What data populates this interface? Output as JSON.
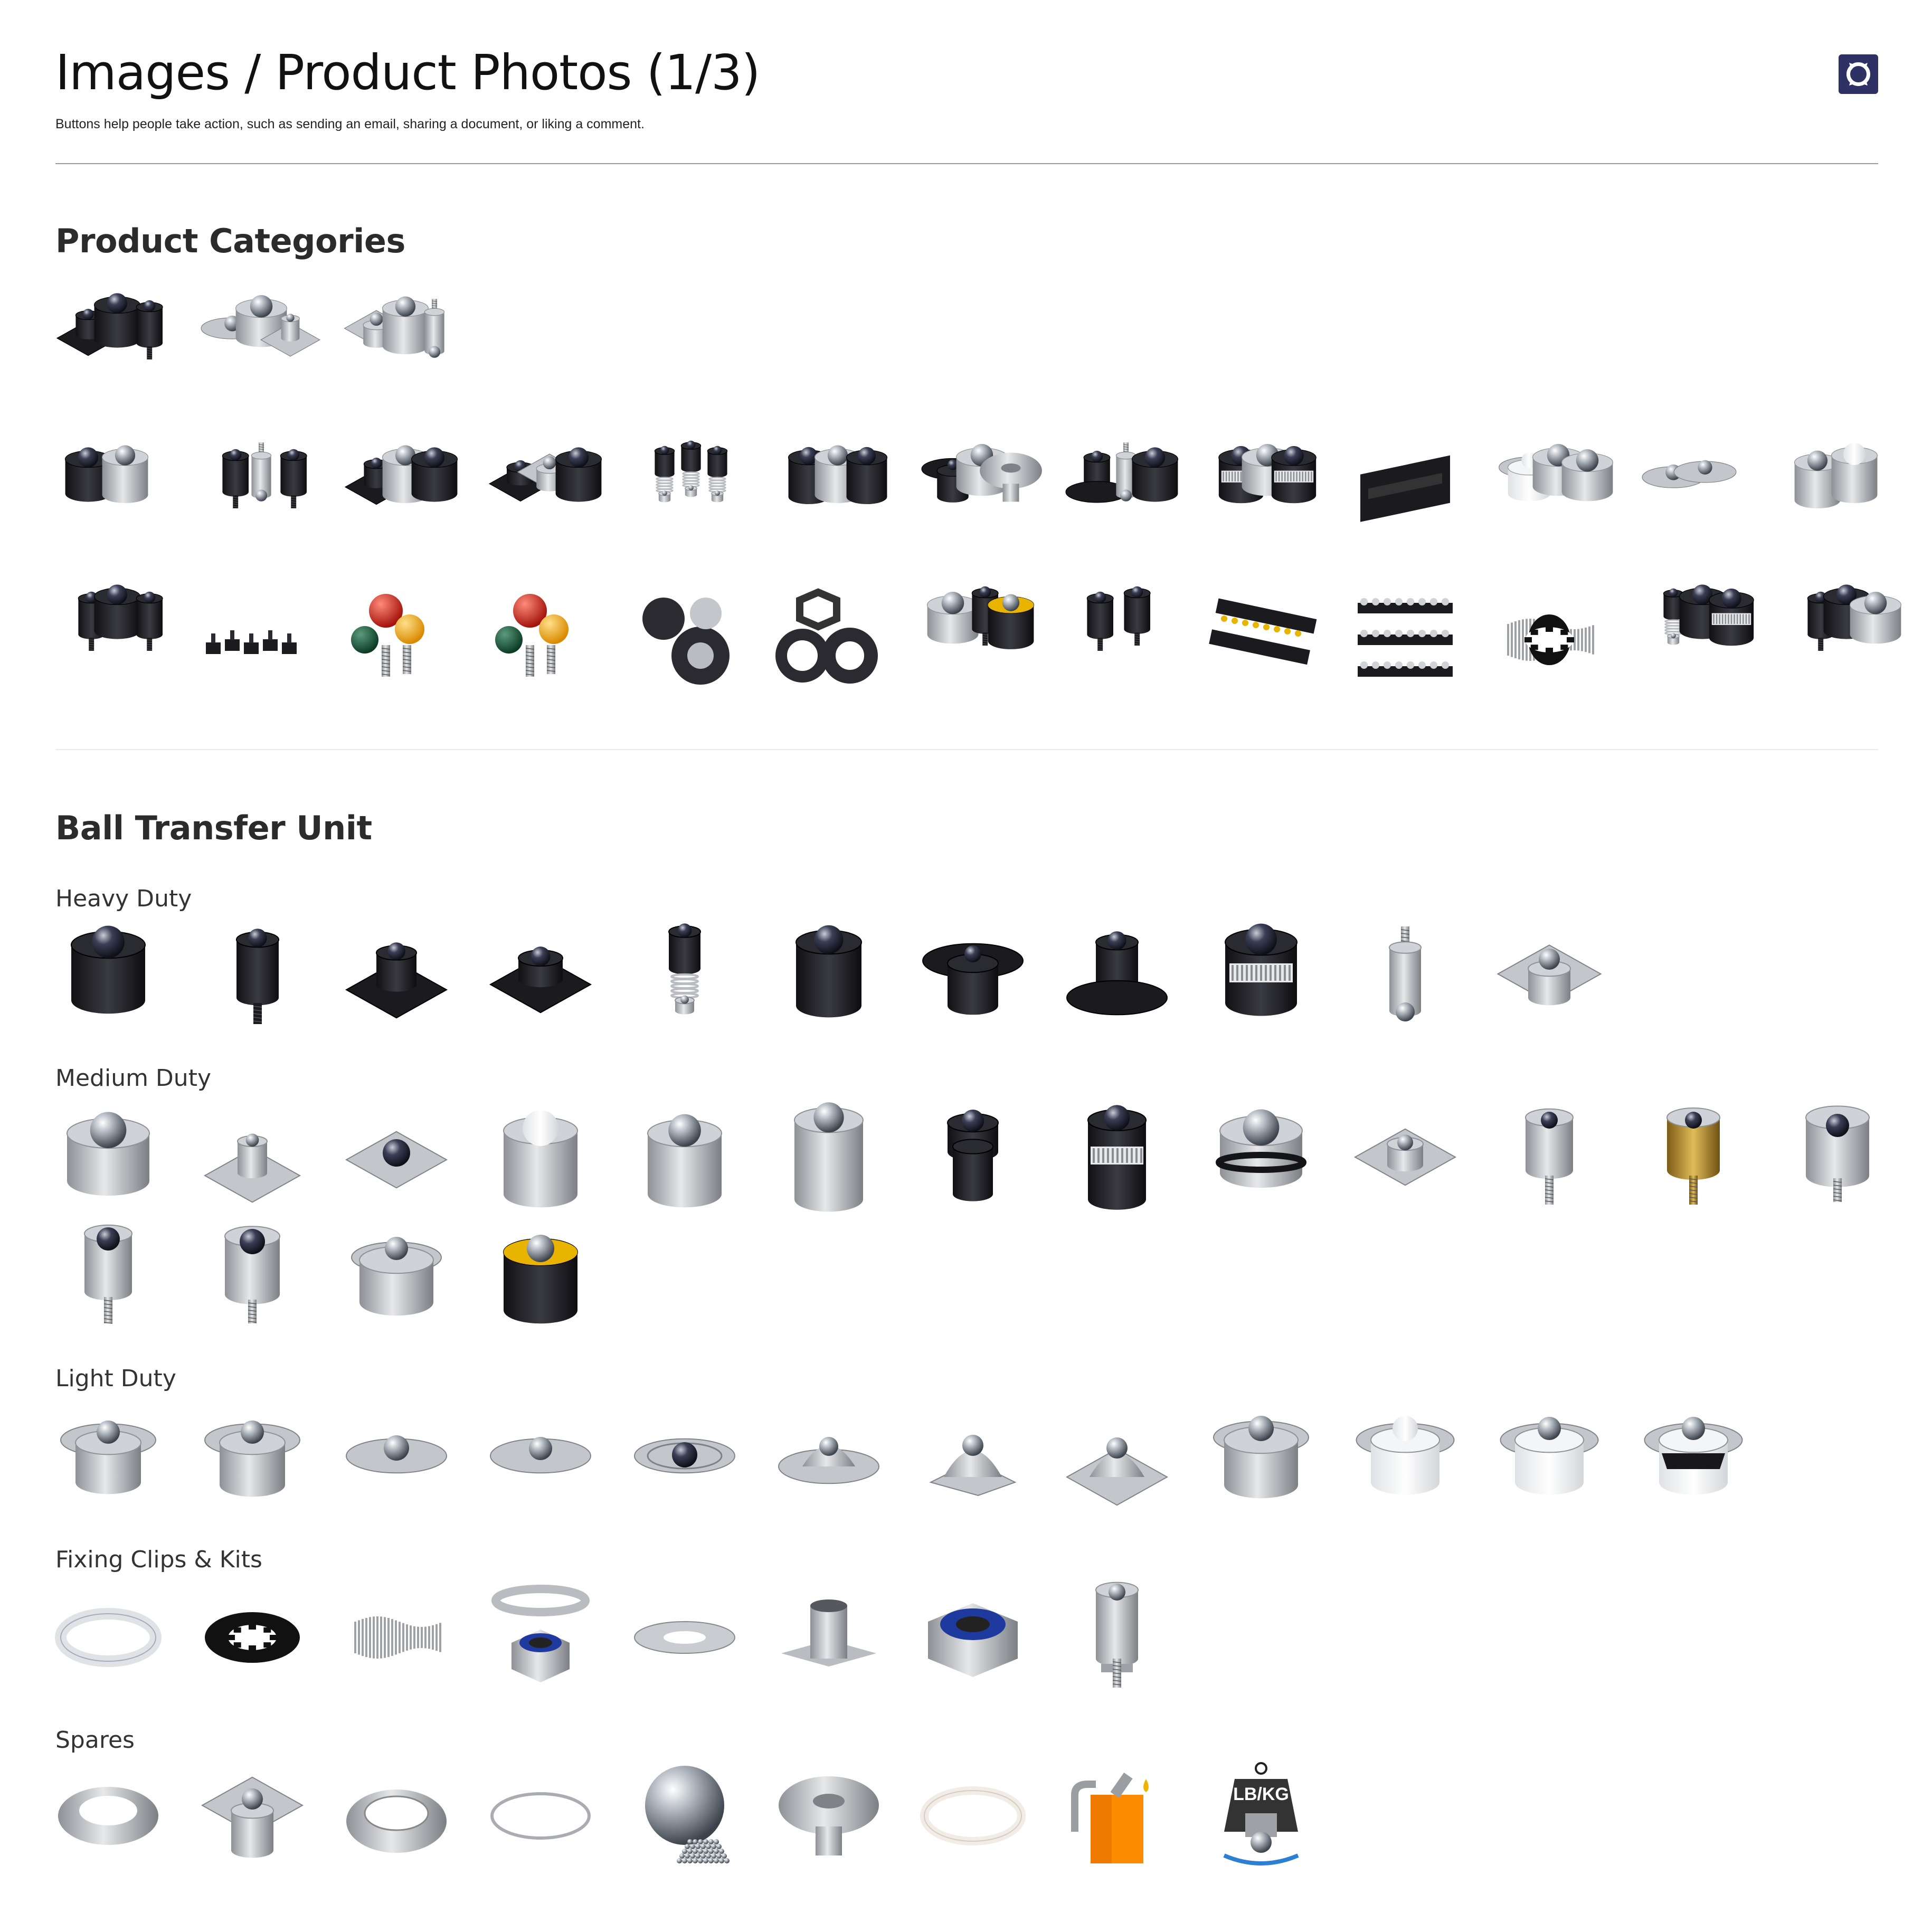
{
  "header": {
    "title": "Images / Product Photos (1/3)",
    "subtitle": "Buttons help people take action, such as sending an email, sharing a document, or liking a comment.",
    "logo_icon": "brand-logo-icon",
    "logo_color": "#2e3163"
  },
  "categories": {
    "title": "Product Categories",
    "rows": [
      [
        "group-black-units",
        "group-silver-units",
        "group-cylinder-units"
      ],
      [
        "black-silver-pair",
        "black-stud-set",
        "black-square-flange-set",
        "black-flange-set",
        "spring-loaded-set",
        "black-cylinder-set",
        "black-round-flange-set",
        "black-domed-flange-set",
        "knurled-set",
        "linear-rail-blocks",
        "white-silver-set",
        "silver-flange-pair",
        "silver-cylinder-pair"
      ],
      [
        "black-pendant-set",
        "black-feet-row",
        "colored-knob-balls",
        "colored-knob-balls-alt",
        "omni-wheels",
        "black-washers",
        "pneumatic-silver-set",
        "pneumatic-black-set",
        "black-rail-strips",
        "rail-strips-stack",
        "clip-kit",
        "spring-black-set",
        "pneumatic-mixed-set"
      ]
    ]
  },
  "ball_transfer": {
    "title": "Ball Transfer Unit",
    "groups": [
      {
        "label": "Heavy Duty",
        "items": [
          "black-cup-unit",
          "black-stud-unit",
          "black-square-flange-unit",
          "black-flange-unit",
          "spring-loaded-unit",
          "black-cylinder-unit",
          "black-round-flange-unit",
          "black-domed-flange-unit",
          "knurled-black-unit",
          "silver-stud-unit",
          "silver-square-flange-unit"
        ]
      },
      {
        "label": "Medium Duty",
        "items": [
          "silver-cup-unit",
          "silver-small-flange-unit",
          "square-plate-unit",
          "white-ball-cylinder-unit",
          "silver-cylinder-unit",
          "tall-silver-cylinder-unit",
          "black-press-fit-unit",
          "knurled-press-fit-unit",
          "o-ring-cup-unit",
          "mini-flange-unit",
          "silver-stud-ball-unit",
          "brass-stud-unit",
          "silver-bolt-unit",
          "silver-short-stud-unit",
          "silver-collar-stud-unit",
          "silver-wide-cup-unit",
          "yellow-ring-black-unit"
        ]
      },
      {
        "label": "Light Duty",
        "items": [
          "light-cup-unit",
          "light-steel-cup-unit",
          "light-flange-unit",
          "light-wide-flange-unit",
          "light-dark-ball-flange",
          "light-dome-flange",
          "light-triangle-flange",
          "light-square-flange",
          "light-large-cup-unit",
          "white-plastic-unit",
          "white-plastic-steel-ball",
          "white-plastic-cutaway"
        ]
      },
      {
        "label": "Fixing Clips & Kits",
        "items": [
          "white-star-clip",
          "black-star-clip",
          "spring-band",
          "lock-nut-washer",
          "flat-washer",
          "tee-nut",
          "nylon-lock-nut",
          "stud-bolt-kit"
        ]
      },
      {
        "label": "Spares",
        "items": [
          "steel-ring-spare",
          "flange-housing-spare",
          "thick-ring-spare",
          "wire-ring-spare",
          "steel-balls-spare",
          "mushroom-cap-spare",
          "white-seal-ring",
          "oil-can-icon",
          "load-scale-icon"
        ]
      }
    ],
    "scale_badge": "LB/KG"
  },
  "colors": {
    "steel": "#b9bcc0",
    "steel_dark": "#7e8287",
    "black_body": "#1d1d22",
    "orange": "#ff8c00",
    "brass": "#b58a2c"
  }
}
